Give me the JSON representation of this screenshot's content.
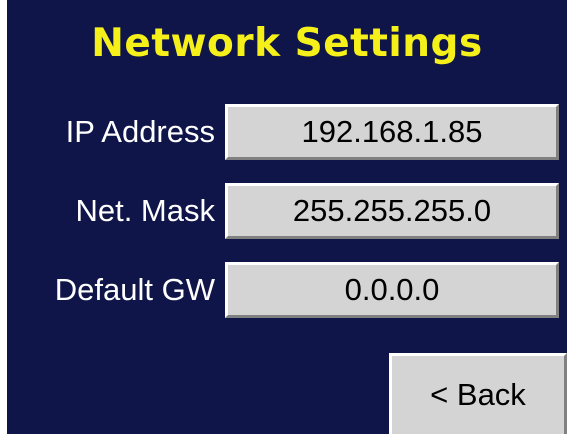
{
  "screen": {
    "title": "Network Settings",
    "colors": {
      "background": "#0f1548",
      "title": "#f6f01a",
      "label": "#ffffff",
      "button_face": "#d4d4d4"
    }
  },
  "fields": [
    {
      "label": "IP Address",
      "value": "192.168.1.85"
    },
    {
      "label": "Net. Mask",
      "value": "255.255.255.0"
    },
    {
      "label": "Default GW",
      "value": "0.0.0.0"
    }
  ],
  "back_button": {
    "label": "< Back"
  }
}
